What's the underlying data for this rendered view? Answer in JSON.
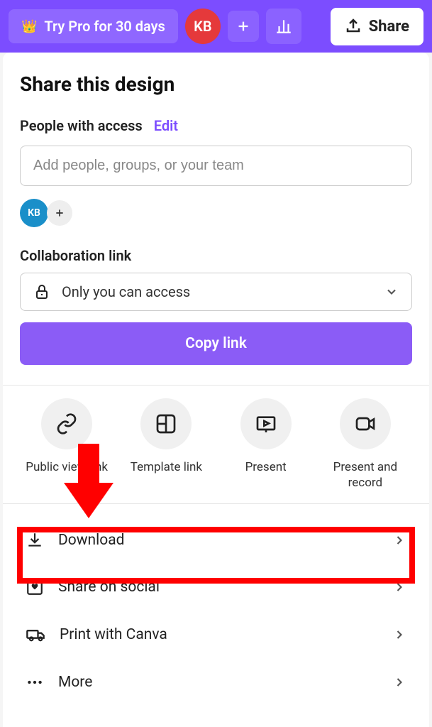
{
  "header": {
    "try_pro_label": "Try Pro for 30 days",
    "avatar_initials": "KB",
    "share_label": "Share"
  },
  "panel": {
    "title": "Share this design",
    "people_label": "People with access",
    "edit_label": "Edit",
    "add_placeholder": "Add people, groups, or your team",
    "small_avatar_initials": "KB",
    "collab_label": "Collaboration link",
    "collab_value": "Only you can access",
    "copy_link_label": "Copy link"
  },
  "actions": [
    {
      "label": "Public view link"
    },
    {
      "label": "Template link"
    },
    {
      "label": "Present"
    },
    {
      "label": "Present and record"
    }
  ],
  "list": [
    {
      "label": "Download"
    },
    {
      "label": "Share on social"
    },
    {
      "label": "Print with Canva"
    },
    {
      "label": "More"
    }
  ]
}
